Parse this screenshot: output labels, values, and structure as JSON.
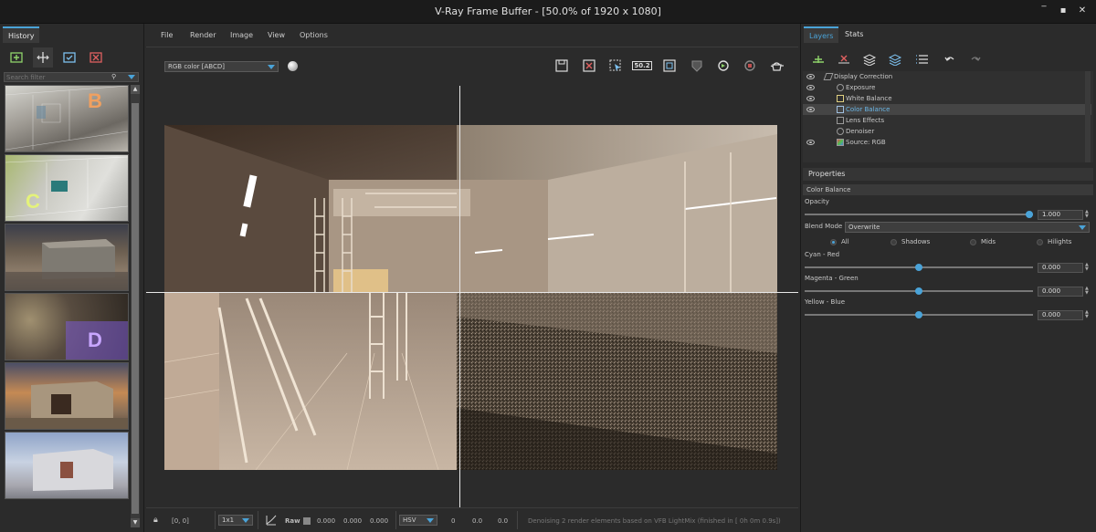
{
  "window": {
    "title": "V-Ray Frame Buffer - [50.0% of 1920 x 1080]",
    "minimize": "‾",
    "maximize": "▪",
    "close": "✕"
  },
  "history": {
    "tab": "History",
    "search_placeholder": "Search filter",
    "thumbs": [
      "B",
      "C",
      "",
      "D",
      "",
      ""
    ]
  },
  "menu": [
    "File",
    "Render",
    "Image",
    "View",
    "Options"
  ],
  "toolbar": {
    "channel": "RGB color [ABCD]",
    "test_res": "50.2"
  },
  "status": {
    "coords": "[0, 0]",
    "zoom": "1x1",
    "raw": "Raw",
    "r": "0.000",
    "g": "0.000",
    "b": "0.000",
    "mode": "HSV",
    "h": "0",
    "s": "0.0",
    "v": "0.0",
    "message": "Denoising 2 render elements based on VFB LightMix (finished in [ 0h  0m  0.9s])"
  },
  "right": {
    "tabs": [
      "Layers",
      "Stats"
    ],
    "layers": [
      {
        "name": "Display Correction",
        "eye": true,
        "indent": 0,
        "selected": false
      },
      {
        "name": "Exposure",
        "eye": true,
        "indent": 1,
        "selected": false
      },
      {
        "name": "White Balance",
        "eye": true,
        "indent": 1,
        "selected": false
      },
      {
        "name": "Color Balance",
        "eye": true,
        "indent": 1,
        "selected": true
      },
      {
        "name": "Lens Effects",
        "eye": false,
        "indent": 1,
        "selected": false
      },
      {
        "name": "Denoiser",
        "eye": false,
        "indent": 1,
        "selected": false
      },
      {
        "name": "Source: RGB",
        "eye": true,
        "indent": 1,
        "selected": false
      }
    ],
    "properties_title": "Properties",
    "layer_name": "Color Balance",
    "opacity_label": "Opacity",
    "opacity_value": "1.000",
    "opacity_fraction": 1.0,
    "blend_label": "Blend Mode",
    "blend_value": "Overwrite",
    "ranges": [
      "All",
      "Shadows",
      "Mids",
      "Hilights"
    ],
    "cyan_label": "Cyan - Red",
    "cyan_value": "0.000",
    "magenta_label": "Magenta - Green",
    "magenta_value": "0.000",
    "yellow_label": "Yellow - Blue",
    "yellow_value": "0.000"
  },
  "colors": {
    "accent": "#4aa3d8",
    "selected_layer_text": "#6ab6e6"
  }
}
